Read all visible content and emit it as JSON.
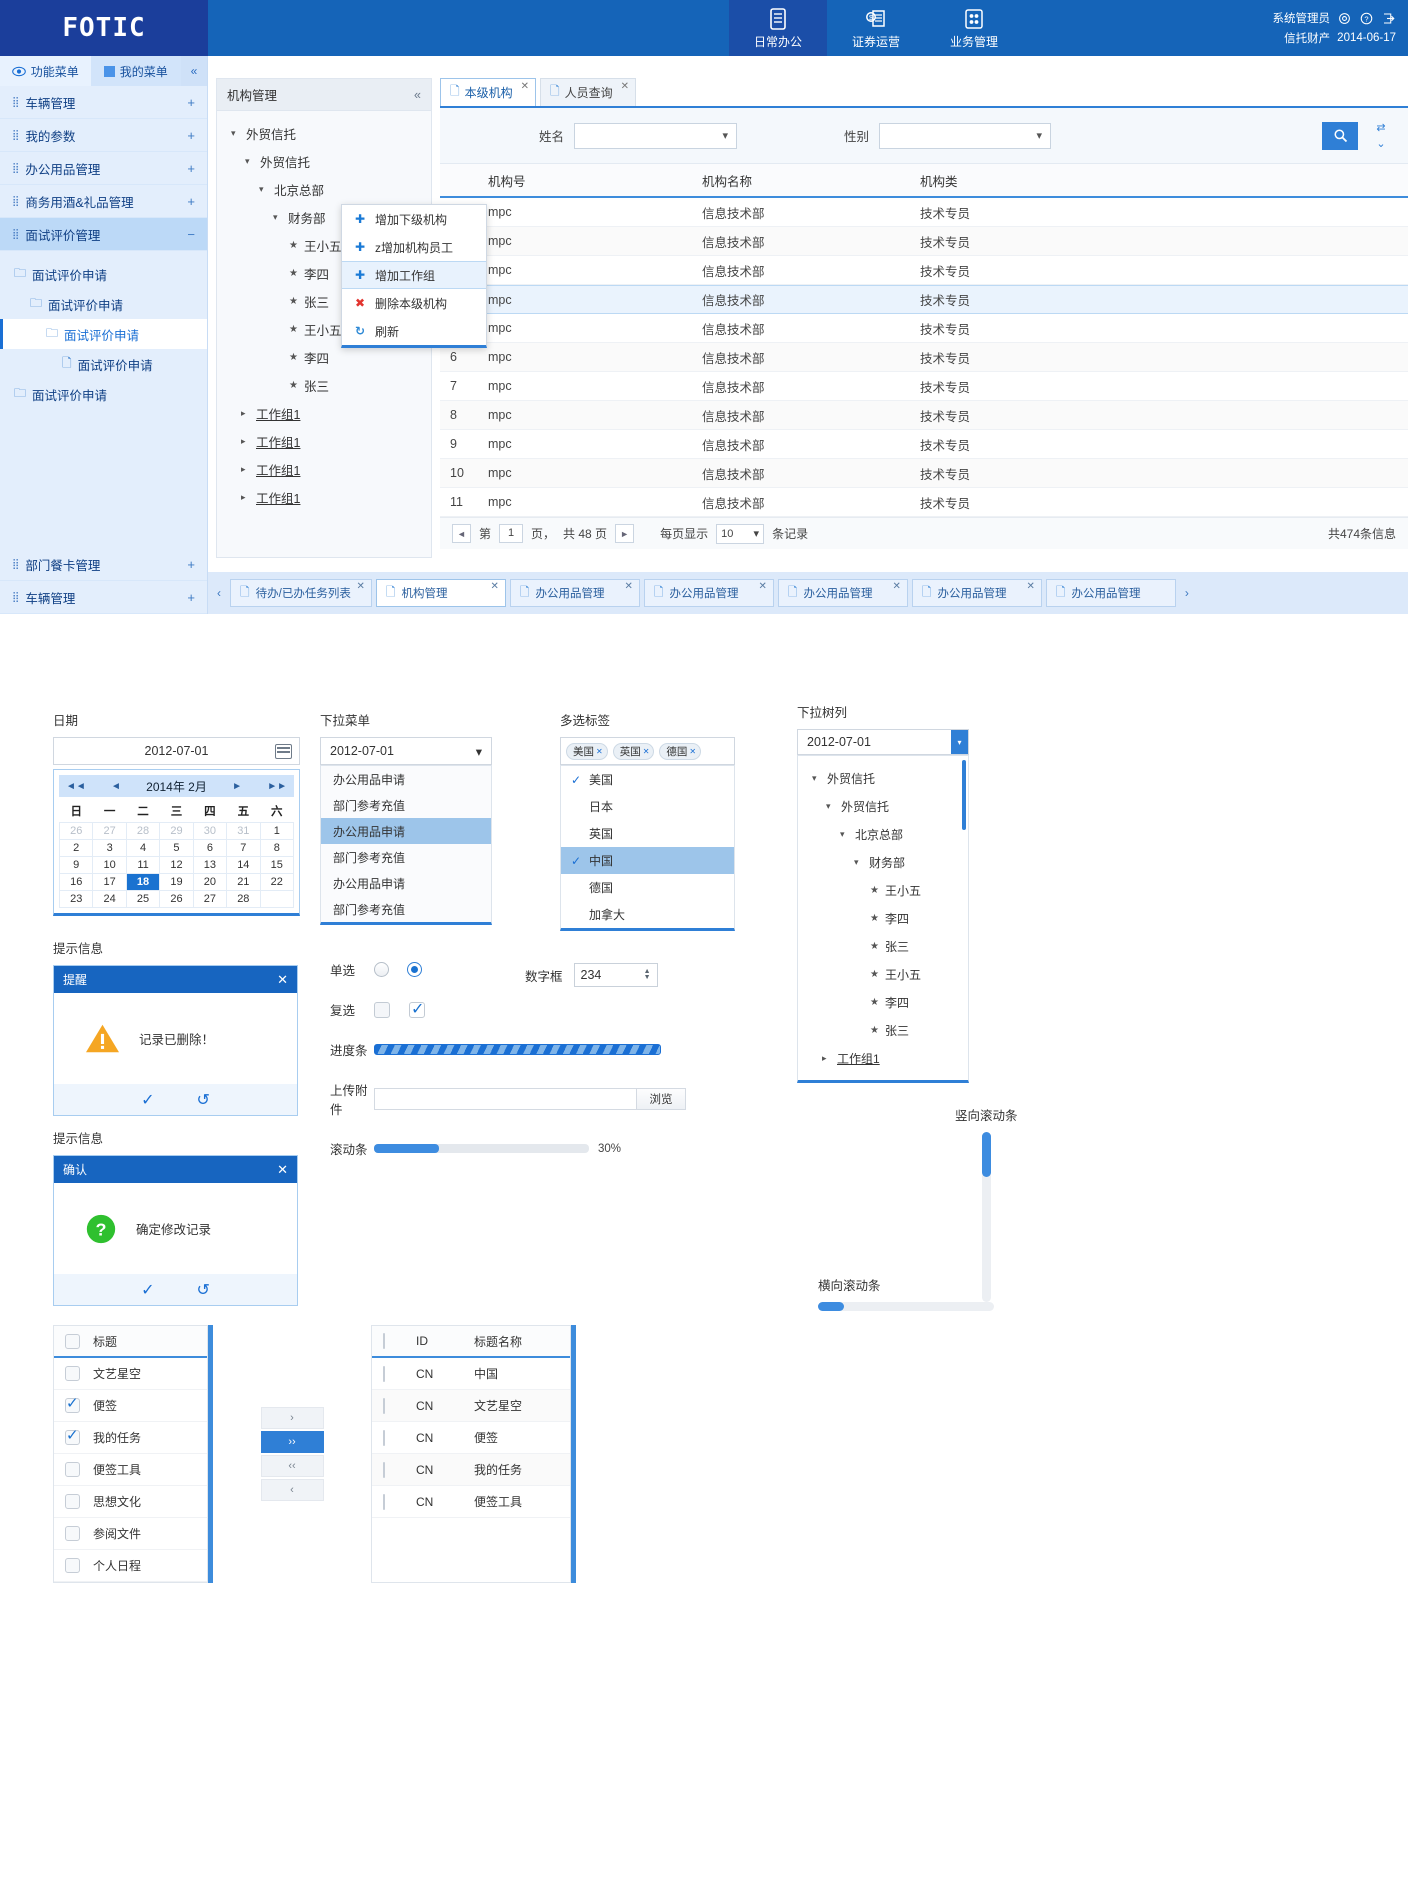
{
  "header": {
    "logo": "FOTIC",
    "nav": [
      {
        "label": "日常办公",
        "icon": "document-icon",
        "active": true
      },
      {
        "label": "证券运营",
        "icon": "coin-stack-icon",
        "active": false
      },
      {
        "label": "业务管理",
        "icon": "grid-icon",
        "active": false
      }
    ],
    "user_name": "系统管理员",
    "user_org": "信托财产",
    "date": "2014-06-17"
  },
  "sidebar": {
    "tabs": [
      {
        "label": "功能菜单",
        "icon": "eye-icon",
        "active": true
      },
      {
        "label": "我的菜单",
        "icon": "square-icon",
        "active": false
      }
    ],
    "collapse": "«",
    "menu": [
      {
        "label": "车辆管理",
        "expander": "+",
        "active": false
      },
      {
        "label": "我的参数",
        "expander": "+",
        "active": false
      },
      {
        "label": "办公用品管理",
        "expander": "+",
        "active": false
      },
      {
        "label": "商务用酒&礼品管理",
        "expander": "+",
        "active": false
      },
      {
        "label": "面试评价管理",
        "expander": "−",
        "active": true
      }
    ],
    "tree": [
      {
        "label": "面试评价申请",
        "indent": 0,
        "selected": false
      },
      {
        "label": "面试评价申请",
        "indent": 1,
        "selected": false
      },
      {
        "label": "面试评价申请",
        "indent": 2,
        "selected": true
      },
      {
        "label": "面试评价申请",
        "indent": 3,
        "selected": false
      },
      {
        "label": "面试评价申请",
        "indent": 0,
        "selected": false
      }
    ],
    "bottom_menu": [
      {
        "label": "部门餐卡管理",
        "expander": "+"
      },
      {
        "label": "车辆管理",
        "expander": "+"
      }
    ]
  },
  "org_panel": {
    "title": "机构管理",
    "collapse": "«",
    "tree": [
      {
        "label": "外贸信托",
        "indent": 0,
        "caret": "▾",
        "leaf": false
      },
      {
        "label": "外贸信托",
        "indent": 1,
        "caret": "▾",
        "leaf": false
      },
      {
        "label": "北京总部",
        "indent": 2,
        "caret": "▾",
        "leaf": false
      },
      {
        "label": "财务部",
        "indent": 3,
        "caret": "▾",
        "leaf": false
      },
      {
        "label": "王小五",
        "indent": 4,
        "caret": "★",
        "leaf": true
      },
      {
        "label": "李四",
        "indent": 4,
        "caret": "★",
        "leaf": true
      },
      {
        "label": "张三",
        "indent": 4,
        "caret": "★",
        "leaf": true
      },
      {
        "label": "王小五",
        "indent": 4,
        "caret": "★",
        "leaf": true
      },
      {
        "label": "李四",
        "indent": 4,
        "caret": "★",
        "leaf": true
      },
      {
        "label": "张三",
        "indent": 4,
        "caret": "★",
        "leaf": true
      },
      {
        "label": "工作组1",
        "indent": 1,
        "caret": "▸",
        "leaf": false
      },
      {
        "label": "工作组1",
        "indent": 1,
        "caret": "▸",
        "leaf": false
      },
      {
        "label": "工作组1",
        "indent": 1,
        "caret": "▸",
        "leaf": false
      },
      {
        "label": "工作组1",
        "indent": 1,
        "caret": "▸",
        "leaf": false
      }
    ]
  },
  "context_menu": [
    {
      "label": "增加下级机构",
      "icon": "plus-icon",
      "kind": "plus",
      "highlight": false
    },
    {
      "label": "z增加机构员工",
      "icon": "plus-icon",
      "kind": "plus",
      "highlight": false
    },
    {
      "label": "增加工作组",
      "icon": "plus-icon",
      "kind": "plus",
      "highlight": true
    },
    {
      "label": "删除本级机构",
      "icon": "close-x-icon",
      "kind": "x",
      "highlight": false
    },
    {
      "label": "刷新",
      "icon": "refresh-icon",
      "kind": "refresh",
      "highlight": false
    }
  ],
  "content_tabs": [
    {
      "label": "本级机构",
      "active": true
    },
    {
      "label": "人员查询",
      "active": false
    }
  ],
  "search_form": {
    "name_label": "姓名",
    "name_value": "",
    "gender_label": "性别",
    "gender_value": "",
    "search_icon": "search-icon"
  },
  "grid": {
    "columns": [
      "",
      "机构号",
      "机构名称",
      "机构类"
    ],
    "rows": [
      {
        "idx": "",
        "num": "mpc",
        "name": "信息技术部",
        "type": "技术专员",
        "alt": false,
        "sel": false
      },
      {
        "idx": "",
        "num": "mpc",
        "name": "信息技术部",
        "type": "技术专员",
        "alt": true,
        "sel": false
      },
      {
        "idx": "",
        "num": "mpc",
        "name": "信息技术部",
        "type": "技术专员",
        "alt": false,
        "sel": false
      },
      {
        "idx": "",
        "num": "mpc",
        "name": "信息技术部",
        "type": "技术专员",
        "alt": false,
        "sel": true
      },
      {
        "idx": "",
        "num": "mpc",
        "name": "信息技术部",
        "type": "技术专员",
        "alt": false,
        "sel": false
      },
      {
        "idx": "6",
        "num": "mpc",
        "name": "信息技术部",
        "type": "技术专员",
        "alt": true,
        "sel": false
      },
      {
        "idx": "7",
        "num": "mpc",
        "name": "信息技术部",
        "type": "技术专员",
        "alt": false,
        "sel": false
      },
      {
        "idx": "8",
        "num": "mpc",
        "name": "信息技术部",
        "type": "技术专员",
        "alt": true,
        "sel": false
      },
      {
        "idx": "9",
        "num": "mpc",
        "name": "信息技术部",
        "type": "技术专员",
        "alt": false,
        "sel": false
      },
      {
        "idx": "10",
        "num": "mpc",
        "name": "信息技术部",
        "type": "技术专员",
        "alt": true,
        "sel": false
      },
      {
        "idx": "11",
        "num": "mpc",
        "name": "信息技术部",
        "type": "技术专员",
        "alt": false,
        "sel": false
      }
    ]
  },
  "pager": {
    "prev": "◄",
    "next": "►",
    "page_prefix": "第",
    "page_value": "1",
    "page_suffix": "页，",
    "total_pages": "共 48 页",
    "per_page_label": "每页显示",
    "per_page_value": "10",
    "records_label": "条记录",
    "total_records": "共474条信息"
  },
  "bottom_tabs": [
    {
      "label": "待办/已办任务列表",
      "active": false
    },
    {
      "label": "机构管理",
      "active": true
    },
    {
      "label": "办公用品管理",
      "active": false
    },
    {
      "label": "办公用品管理",
      "active": false
    },
    {
      "label": "办公用品管理",
      "active": false
    },
    {
      "label": "办公用品管理",
      "active": false
    },
    {
      "label": "办公用品管理",
      "active": false
    }
  ],
  "gallery": {
    "date_section": {
      "label": "日期",
      "input_value": "2012-07-01",
      "calendar": {
        "title": "2014年  2月",
        "first": "◄◄",
        "prev": "◄",
        "next": "►",
        "last": "►►",
        "weekdays": [
          "日",
          "一",
          "二",
          "三",
          "四",
          "五",
          "六"
        ],
        "weeks": [
          [
            {
              "d": "26",
              "mute": true
            },
            {
              "d": "27",
              "mute": true
            },
            {
              "d": "28",
              "mute": true
            },
            {
              "d": "29",
              "mute": true
            },
            {
              "d": "30",
              "mute": true
            },
            {
              "d": "31",
              "mute": true
            },
            {
              "d": "1",
              "mute": false
            }
          ],
          [
            {
              "d": "2"
            },
            {
              "d": "3"
            },
            {
              "d": "4"
            },
            {
              "d": "5"
            },
            {
              "d": "6"
            },
            {
              "d": "7"
            },
            {
              "d": "8"
            }
          ],
          [
            {
              "d": "9"
            },
            {
              "d": "10"
            },
            {
              "d": "11"
            },
            {
              "d": "12"
            },
            {
              "d": "13"
            },
            {
              "d": "14"
            },
            {
              "d": "15"
            }
          ],
          [
            {
              "d": "16"
            },
            {
              "d": "17"
            },
            {
              "d": "18",
              "today": true
            },
            {
              "d": "19"
            },
            {
              "d": "20"
            },
            {
              "d": "21"
            },
            {
              "d": "22"
            }
          ],
          [
            {
              "d": "23"
            },
            {
              "d": "24"
            },
            {
              "d": "25"
            },
            {
              "d": "26"
            },
            {
              "d": "27"
            },
            {
              "d": "28"
            },
            {
              "d": "",
              "empty": true
            }
          ]
        ]
      }
    },
    "dropdown_section": {
      "label": "下拉菜单",
      "input_value": "2012-07-01",
      "arrow": "▾",
      "items": [
        {
          "label": "办公用品申请",
          "sel": false
        },
        {
          "label": "部门参考充值",
          "sel": false
        },
        {
          "label": "办公用品申请",
          "sel": true
        },
        {
          "label": "部门参考充值",
          "sel": false
        },
        {
          "label": "办公用品申请",
          "sel": false
        },
        {
          "label": "部门参考充值",
          "sel": false
        }
      ]
    },
    "multiselect_section": {
      "label": "多选标签",
      "tags": [
        "美国",
        "英国",
        "德国"
      ],
      "items": [
        {
          "label": "美国",
          "checked": true,
          "sel": false
        },
        {
          "label": "日本",
          "checked": false,
          "sel": false
        },
        {
          "label": "英国",
          "checked": false,
          "sel": false
        },
        {
          "label": "中国",
          "checked": true,
          "sel": true
        },
        {
          "label": "德国",
          "checked": false,
          "sel": false
        },
        {
          "label": "加拿大",
          "checked": false,
          "sel": false
        }
      ]
    },
    "treedrop_section": {
      "label": "下拉树列",
      "input_value": "2012-07-01",
      "arrow": "▾",
      "tree": [
        {
          "label": "外贸信托",
          "indent": 0,
          "caret": "▾"
        },
        {
          "label": "外贸信托",
          "indent": 1,
          "caret": "▾"
        },
        {
          "label": "北京总部",
          "indent": 2,
          "caret": "▾"
        },
        {
          "label": "财务部",
          "indent": 3,
          "caret": "▾"
        },
        {
          "label": "王小五",
          "indent": 4,
          "caret": "★"
        },
        {
          "label": "李四",
          "indent": 4,
          "caret": "★"
        },
        {
          "label": "张三",
          "indent": 4,
          "caret": "★"
        },
        {
          "label": "王小五",
          "indent": 4,
          "caret": "★"
        },
        {
          "label": "李四",
          "indent": 4,
          "caret": "★"
        },
        {
          "label": "张三",
          "indent": 4,
          "caret": "★"
        },
        {
          "label": "工作组1",
          "indent": 1,
          "caret": "▸"
        }
      ]
    },
    "dialog_alert": {
      "section_label": "提示信息",
      "title": "提醒",
      "close": "✕",
      "icon": "warning-triangle-icon",
      "message": "记录已删除！",
      "ok": "✓",
      "reset": "↺"
    },
    "dialog_confirm": {
      "section_label": "提示信息",
      "title": "确认",
      "close": "✕",
      "icon": "question-circle-icon",
      "message": "确定修改记录",
      "ok": "✓",
      "reset": "↺"
    },
    "controls": {
      "radio_label": "单选",
      "checkbox_label": "复选",
      "progress_label": "进度条",
      "upload_label": "上传附件",
      "upload_value": "",
      "upload_button": "浏览",
      "slider_label": "滚动条",
      "slider_value": "30%",
      "number_label": "数字框",
      "number_value": "234"
    },
    "scrollbars": {
      "vertical_label": "竖向滚动条",
      "horizontal_label": "横向滚动条"
    },
    "transfer": {
      "left_header": "标题",
      "left_items": [
        {
          "label": "文艺星空",
          "checked": false
        },
        {
          "label": "便签",
          "checked": true
        },
        {
          "label": "我的任务",
          "checked": true
        },
        {
          "label": "便签工具",
          "checked": false
        },
        {
          "label": "思想文化",
          "checked": false
        },
        {
          "label": "参阅文件",
          "checked": false
        },
        {
          "label": "个人日程",
          "checked": false
        }
      ],
      "buttons": [
        {
          "label": "›",
          "active": false
        },
        {
          "label": "››",
          "active": true
        },
        {
          "label": "‹‹",
          "active": false
        },
        {
          "label": "‹",
          "active": false
        }
      ],
      "right_columns": [
        "",
        "ID",
        "标题名称"
      ],
      "right_rows": [
        {
          "id": "CN",
          "name": "中国",
          "alt": false
        },
        {
          "id": "CN",
          "name": "文艺星空",
          "alt": true
        },
        {
          "id": "CN",
          "name": "便签",
          "alt": false
        },
        {
          "id": "CN",
          "name": "我的任务",
          "alt": true
        },
        {
          "id": "CN",
          "name": "便签工具",
          "alt": false
        }
      ]
    }
  },
  "colors": {
    "brand_dark": "#1b3e9b",
    "brand": "#1564b8",
    "accent": "#2f7fd6",
    "warning": "#f5a623",
    "success": "#2fc02f",
    "danger": "#e2342f"
  }
}
